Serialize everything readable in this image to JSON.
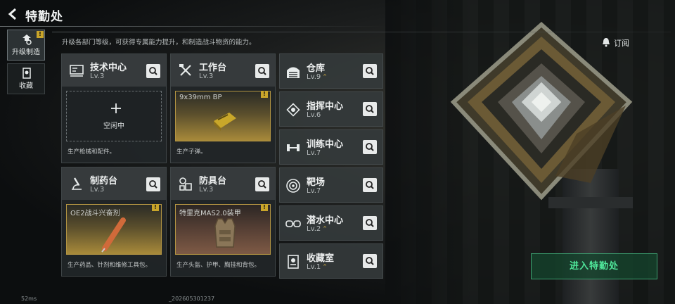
{
  "header": {
    "title": "特勤处"
  },
  "sidenav": [
    {
      "label": "升级制造",
      "icon": "upgrade-icon",
      "active": true,
      "badge": "!"
    },
    {
      "label": "收藏",
      "icon": "collection-icon",
      "active": false
    }
  ],
  "description": "升级各部门等级，可获得专属能力提升，和制造战斗物资的能力。",
  "subscribe": {
    "label": "订阅",
    "icon": "bell-icon"
  },
  "craft_cards": [
    {
      "name": "技术中心",
      "level": "Lv.3",
      "icon": "tech-center-icon",
      "slot_state": "idle",
      "slot_text": "空闲中",
      "footer": "生产枪械和配件。"
    },
    {
      "name": "工作台",
      "level": "Lv.3",
      "icon": "hammer-icon",
      "slot_state": "crafting",
      "item": "9x39mm BP",
      "badge": "!",
      "footer": "生产子弹。"
    },
    {
      "name": "制药台",
      "level": "Lv.3",
      "icon": "microscope-icon",
      "slot_state": "crafting",
      "item": "OE2战斗兴奋剂",
      "badge": "!",
      "footer": "生产药品、针剂和维修工具包。"
    },
    {
      "name": "防具台",
      "level": "Lv.3",
      "icon": "armor-icon",
      "slot_state": "crafting",
      "item": "特里克MAS2.0装甲",
      "badge": "!",
      "footer": "生产头盔、护甲、胸挂和背包。"
    }
  ],
  "side_cards": [
    {
      "name": "仓库",
      "level": "Lv.9",
      "upgradable": true,
      "icon": "warehouse-icon"
    },
    {
      "name": "指挥中心",
      "level": "Lv.6",
      "upgradable": false,
      "icon": "command-center-icon"
    },
    {
      "name": "训练中心",
      "level": "Lv.7",
      "upgradable": false,
      "icon": "dumbbell-icon"
    },
    {
      "name": "靶场",
      "level": "Lv.7",
      "upgradable": false,
      "icon": "target-icon"
    },
    {
      "name": "潜水中心",
      "level": "Lv.2",
      "upgradable": true,
      "icon": "diving-goggles-icon"
    },
    {
      "name": "收藏室",
      "level": "Lv.1",
      "upgradable": true,
      "icon": "collection-room-icon"
    }
  ],
  "upgrade_glyph": "⌃",
  "enter_button": {
    "label": "进入特勤处"
  },
  "status_bar": {
    "ping": "52ms",
    "session_id": "_202605301237"
  },
  "colors": {
    "accent_green": "#4fe69a",
    "badge_yellow": "#c9a52a"
  }
}
